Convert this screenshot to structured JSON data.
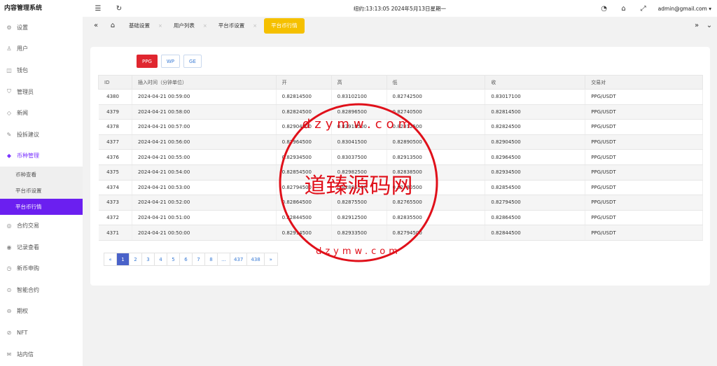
{
  "app": {
    "title": "内容管理系统"
  },
  "header": {
    "clock": "纽约:13:13:05 2024年5月13日星期一",
    "user": "admin@gmail.com ▾"
  },
  "sidebar": {
    "items": [
      {
        "label": "设置",
        "icon": "gear-icon"
      },
      {
        "label": "用户",
        "icon": "user-icon"
      },
      {
        "label": "钱包",
        "icon": "wallet-icon"
      },
      {
        "label": "管理员",
        "icon": "shield-icon"
      },
      {
        "label": "新闻",
        "icon": "tag-icon"
      },
      {
        "label": "投拆建议",
        "icon": "feedback-icon"
      },
      {
        "label": "币种管理",
        "icon": "diamond-icon"
      }
    ],
    "submenu": [
      {
        "label": "币种查看"
      },
      {
        "label": "平台币设置"
      },
      {
        "label": "平台币行情"
      }
    ],
    "items_after": [
      {
        "label": "合约交易",
        "icon": "contract-icon"
      },
      {
        "label": "记录查看",
        "icon": "record-icon"
      },
      {
        "label": "新币申购",
        "icon": "clock-icon"
      },
      {
        "label": "智能合约",
        "icon": "smart-contract-icon"
      },
      {
        "label": "期权",
        "icon": "option-icon"
      },
      {
        "label": "NFT",
        "icon": "nft-icon"
      },
      {
        "label": "站内信",
        "icon": "mail-icon"
      }
    ]
  },
  "tabs": [
    {
      "label": "基础设置"
    },
    {
      "label": "用户列表"
    },
    {
      "label": "平台币设置"
    },
    {
      "label": "平台币行情"
    }
  ],
  "coins": [
    "PPG",
    "WP",
    "GE"
  ],
  "table": {
    "columns": [
      "ID",
      "插入时间（分钟单位）",
      "开",
      "高",
      "低",
      "收",
      "交易对"
    ],
    "rows": [
      [
        "4380",
        "2024-04-21 00:59:00",
        "0.82814500",
        "0.83102100",
        "0.82742500",
        "0.83017100",
        "PPG/USDT"
      ],
      [
        "4379",
        "2024-04-21 00:58:00",
        "0.82824500",
        "0.82896500",
        "0.82740500",
        "0.82814500",
        "PPG/USDT"
      ],
      [
        "4378",
        "2024-04-21 00:57:00",
        "0.82904500",
        "0.82918500",
        "0.82812500",
        "0.82824500",
        "PPG/USDT"
      ],
      [
        "4377",
        "2024-04-21 00:56:00",
        "0.82964500",
        "0.83041500",
        "0.82890500",
        "0.82904500",
        "PPG/USDT"
      ],
      [
        "4376",
        "2024-04-21 00:55:00",
        "0.82934500",
        "0.83037500",
        "0.82913500",
        "0.82964500",
        "PPG/USDT"
      ],
      [
        "4375",
        "2024-04-21 00:54:00",
        "0.82854500",
        "0.82982500",
        "0.82838500",
        "0.82934500",
        "PPG/USDT"
      ],
      [
        "4374",
        "2024-04-21 00:53:00",
        "0.82794500",
        "0.82886500",
        "0.82780500",
        "0.82854500",
        "PPG/USDT"
      ],
      [
        "4373",
        "2024-04-21 00:52:00",
        "0.82864500",
        "0.82875500",
        "0.82765500",
        "0.82794500",
        "PPG/USDT"
      ],
      [
        "4372",
        "2024-04-21 00:51:00",
        "0.82844500",
        "0.82912500",
        "0.82835500",
        "0.82864500",
        "PPG/USDT"
      ],
      [
        "4371",
        "2024-04-21 00:50:00",
        "0.82914500",
        "0.82933500",
        "0.82794500",
        "0.82844500",
        "PPG/USDT"
      ]
    ]
  },
  "pagination": {
    "prev": "«",
    "pages": [
      "1",
      "2",
      "3",
      "4",
      "5",
      "6",
      "7",
      "8",
      "...",
      "437",
      "438"
    ],
    "next": "»",
    "current": "1"
  },
  "watermark": {
    "text": "道臻源码网",
    "url_text": "dzymw.com"
  },
  "colors": {
    "accent": "#6b1ff0",
    "active_tab": "#f5c000",
    "active_coin": "#e0262f",
    "stamp": "#e0101a"
  }
}
